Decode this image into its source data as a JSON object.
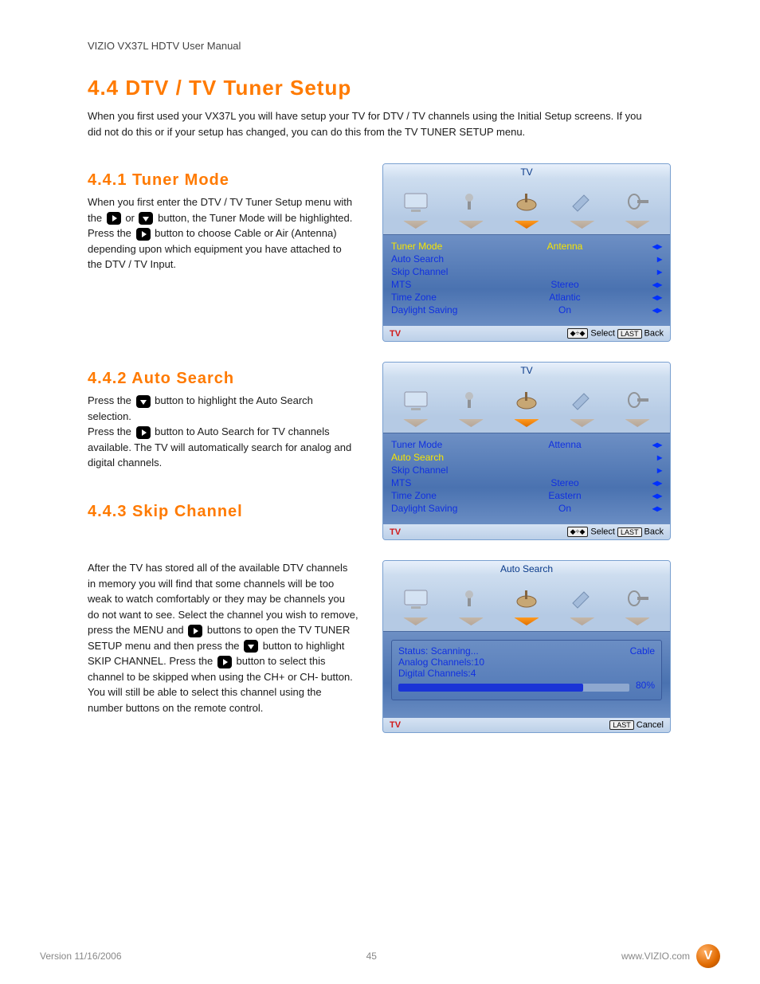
{
  "header": "VIZIO VX37L HDTV User Manual",
  "sectionTitle": "4.4 DTV / TV Tuner Setup",
  "intro": "When you first used your VX37L you will have setup your TV for DTV / TV channels using the Initial Setup screens. If you did not do this or if your setup has changed, you can do this from the TV TUNER SETUP menu.",
  "sections": {
    "tunerMode": {
      "title": "4.4.1 Tuner Mode",
      "p1": "When you first enter the DTV / TV Tuner Setup menu with the ",
      "p2": " or ",
      "p3": " button, the Tuner Mode will be highlighted.",
      "p4": "Press the ",
      "p5": " button to choose Cable or Air (Antenna) depending upon which equipment you have attached to the DTV / TV Input."
    },
    "autoSearch": {
      "title": "4.4.2 Auto Search",
      "p1": "Press the ",
      "p2": " button to highlight the Auto Search selection.",
      "p3": "Press the ",
      "p4": " button to Auto Search for TV channels available. The TV will automatically search for analog and digital channels."
    },
    "skipChannel": {
      "title": "4.4.3 Skip Channel",
      "p1": "After the TV has stored all of the available DTV channels in memory you will find that some channels will be too weak to watch comfortably or they may be channels you do not want to see. Select the channel you wish to remove, press the MENU and ",
      "p2": " buttons to open the TV TUNER SETUP menu and then press the ",
      "p3": " button to highlight SKIP CHANNEL. Press the ",
      "p4": " button to select this channel to be skipped when using the CH+ or CH- button. You will still be able to select this channel using the number buttons on the remote control."
    }
  },
  "panels": {
    "p1": {
      "title": "TV",
      "rows": [
        {
          "label": "Tuner Mode",
          "value": "Antenna",
          "arrow": "lr",
          "hl": true
        },
        {
          "label": "Auto Search",
          "value": "",
          "arrow": "r",
          "hl": false
        },
        {
          "label": "Skip Channel",
          "value": "",
          "arrow": "r",
          "hl": false
        },
        {
          "label": "MTS",
          "value": "Stereo",
          "arrow": "lr",
          "hl": false
        },
        {
          "label": "Time Zone",
          "value": "Atlantic",
          "arrow": "lr",
          "hl": false
        },
        {
          "label": "Daylight Saving",
          "value": "On",
          "arrow": "lr",
          "hl": false
        }
      ],
      "footerLeft": "TV",
      "footerSelect": "Select",
      "footerBack": "Back"
    },
    "p2": {
      "title": "TV",
      "rows": [
        {
          "label": "Tuner Mode",
          "value": "Attenna",
          "arrow": "lr",
          "hl": false
        },
        {
          "label": "Auto Search",
          "value": "",
          "arrow": "r",
          "hl": true
        },
        {
          "label": "Skip Channel",
          "value": "",
          "arrow": "r",
          "hl": false
        },
        {
          "label": "MTS",
          "value": "Stereo",
          "arrow": "lr",
          "hl": false
        },
        {
          "label": "Time Zone",
          "value": "Eastern",
          "arrow": "lr",
          "hl": false
        },
        {
          "label": "Daylight Saving",
          "value": "On",
          "arrow": "lr",
          "hl": false
        }
      ],
      "footerLeft": "TV",
      "footerSelect": "Select",
      "footerBack": "Back"
    },
    "p3": {
      "title": "Auto Search",
      "status": "Status: Scanning...",
      "mode": "Cable",
      "analog": "Analog Channels:10",
      "digital": "Digital Channels:4",
      "progress": 80,
      "progressLabel": "80%",
      "footerLeft": "TV",
      "footerCancel": "Cancel"
    }
  },
  "footer": {
    "version": "Version 11/16/2006",
    "page": "45",
    "copyright": "www.VIZIO.com"
  },
  "nav": {
    "selectKey": "⬥÷⬥",
    "lastKey": "LAST"
  }
}
